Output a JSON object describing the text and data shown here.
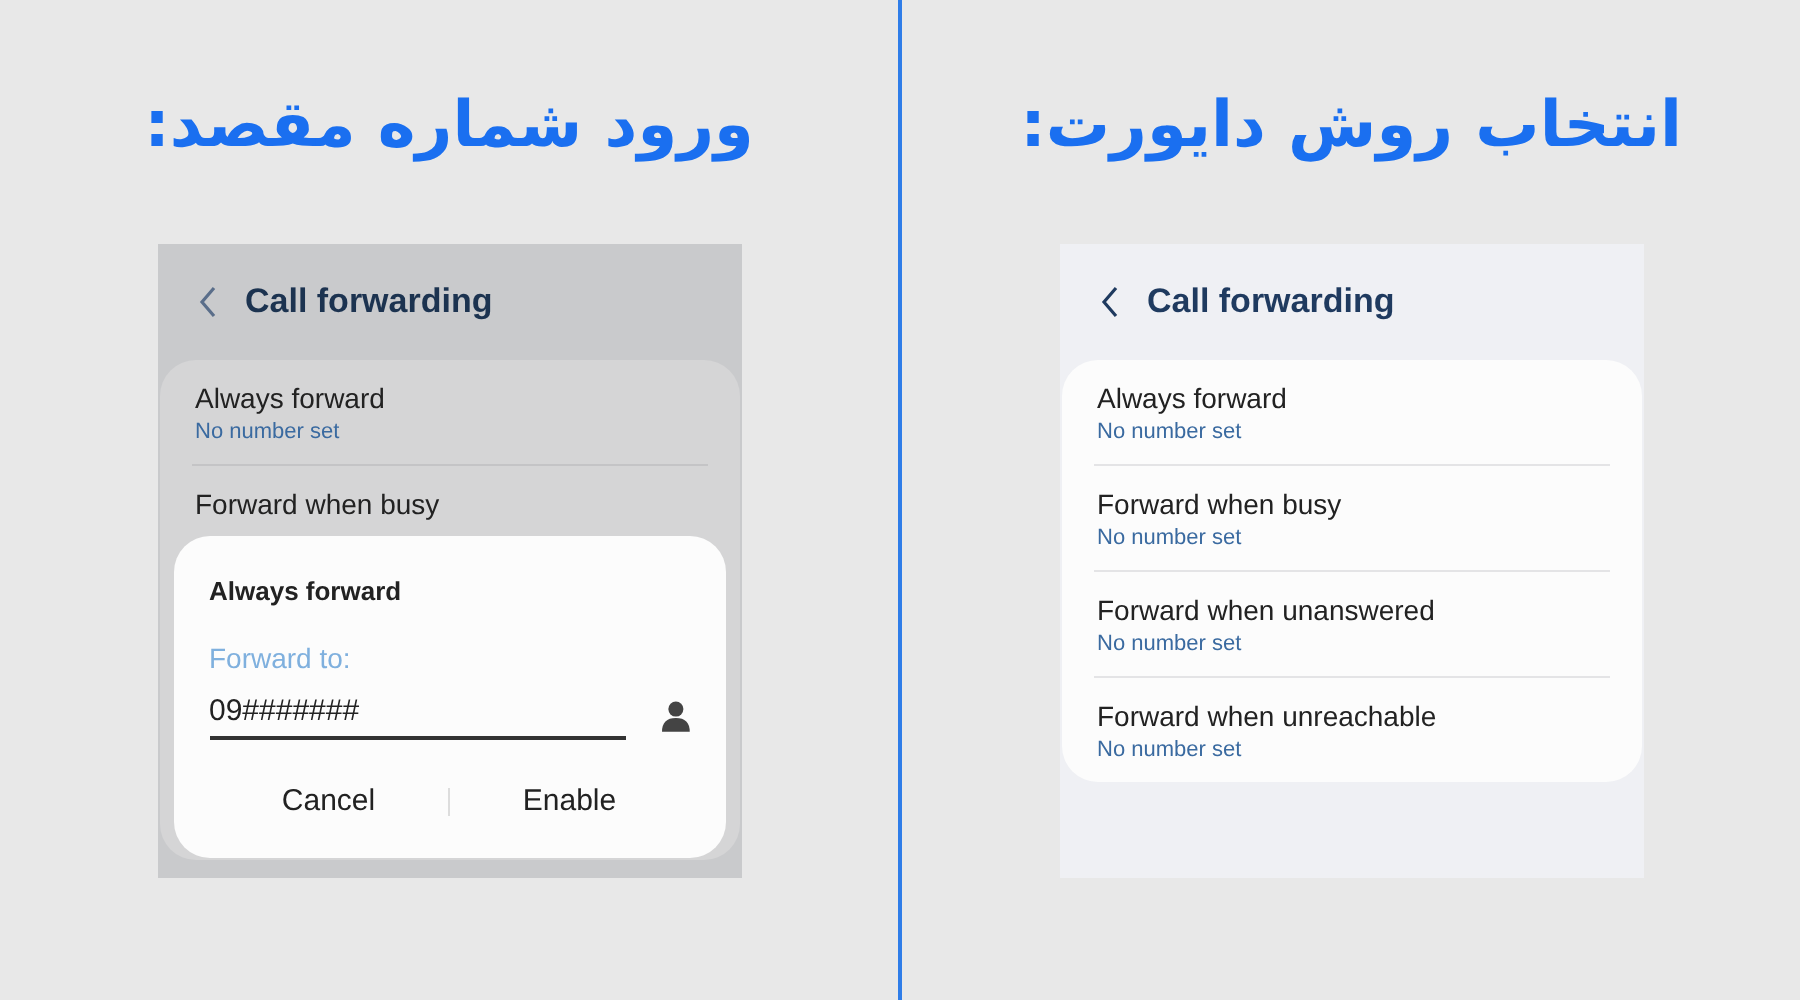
{
  "left": {
    "heading": "ورود شماره مقصد:",
    "screen": {
      "title": "Call forwarding",
      "items": [
        {
          "label": "Always forward",
          "status": "No number set"
        },
        {
          "label": "Forward when busy"
        }
      ]
    },
    "dialog": {
      "title": "Always forward",
      "field": {
        "label": "Forward to:",
        "value": "09#######"
      },
      "buttons": [
        "Cancel",
        "Enable"
      ]
    }
  },
  "right": {
    "heading": "انتخاب روش دایورت:",
    "screen": {
      "title": "Call forwarding",
      "items": [
        {
          "label": "Always forward",
          "status": "No number set"
        },
        {
          "label": "Forward when busy",
          "status": "No number set"
        },
        {
          "label": "Forward when unanswered",
          "status": "No number set"
        },
        {
          "label": "Forward when unreachable",
          "status": "No number set"
        }
      ]
    }
  }
}
